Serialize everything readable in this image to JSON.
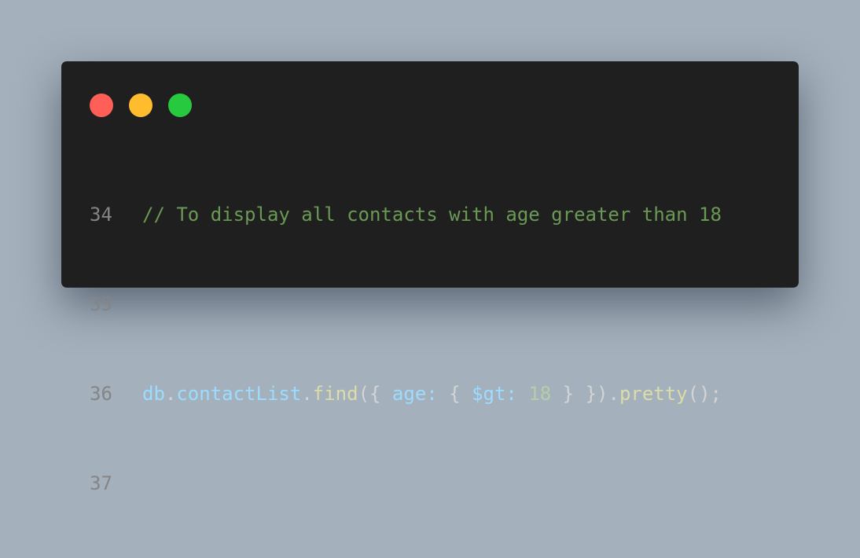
{
  "window": {
    "controls": [
      {
        "name": "close",
        "color": "#ff5f56"
      },
      {
        "name": "minimize",
        "color": "#ffbd2e"
      },
      {
        "name": "maximize",
        "color": "#27c93f"
      }
    ]
  },
  "code": {
    "lines": [
      {
        "number": "34",
        "comment": "// To display all contacts with age greater than 18"
      },
      {
        "number": "35"
      },
      {
        "number": "36",
        "tokens": {
          "db": "db",
          "dot1": ".",
          "collection": "contactList",
          "dot2": ".",
          "method": "find",
          "open": "({ ",
          "field": "age:",
          "mid": " { ",
          "operator": "$gt:",
          "space": " ",
          "value": "18",
          "close": " } }).",
          "method2": "pretty",
          "end": "();"
        }
      },
      {
        "number": "37"
      }
    ]
  }
}
